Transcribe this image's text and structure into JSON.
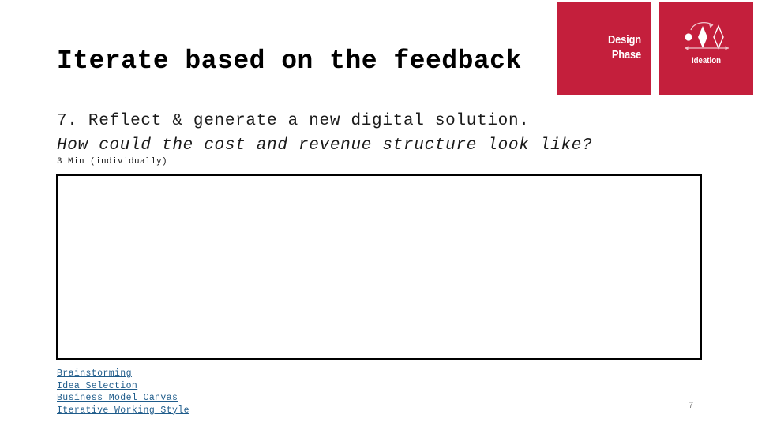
{
  "slide": {
    "title": "Iterate based on the feedback",
    "page_number": "7",
    "prompt": {
      "line_1": "7. Reflect & generate a new digital solution.",
      "line_2": "How could the cost and revenue structure look like?",
      "duration": "3 Min (individually)"
    },
    "answer_box": {
      "value": "",
      "placeholder": ""
    },
    "badges": [
      {
        "name": "design-phase",
        "line_1": "Design",
        "line_2": "Phase",
        "color": "#c41f3c"
      },
      {
        "name": "ideation",
        "label": "Ideation",
        "icon": "ideation-diamonds-icon",
        "color": "#c41f3c"
      }
    ],
    "footer_links": [
      {
        "label": "Brainstorming ",
        "color": "#1f5c8b"
      },
      {
        "label": "Idea Selection",
        "color": "#1f5c8b"
      },
      {
        "label": "Business Model Canvas ",
        "color": "#1f5c8b"
      },
      {
        "label": "Iterative Working Style",
        "color": "#1f5c8b"
      }
    ]
  }
}
